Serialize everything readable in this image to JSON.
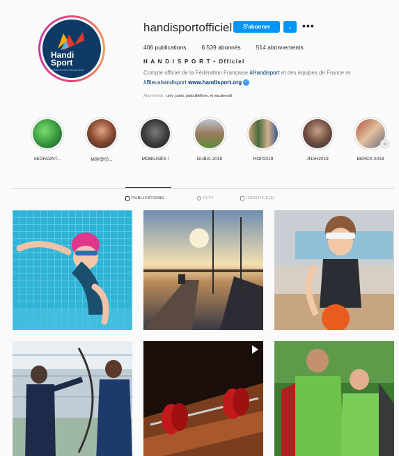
{
  "profile": {
    "username": "handisportofficiel",
    "follow_label": "S'abonner",
    "dropdown_glyph": "⌄",
    "more_glyph": "•••",
    "stats": {
      "publications": "406 publications",
      "followers": "6 539 abonnés",
      "following": "514 abonnements"
    },
    "fullname": "H A N D I S P O R T • Officiel",
    "bio_line1_prefix": "Compte officiel de la Fédération Française ",
    "bio_line1_tag": "#Handisport",
    "bio_line1_suffix": " et des équipes de France re",
    "bio_line2_tag": "#Bleushandisport",
    "bio_link": "www.handisport.org",
    "verified_glyph": "✓",
    "followed_by_prefix": "Abonné(e)s : ",
    "followed_by_names": "univ_paris, patouillefiore, et via.aterodi",
    "avatar_text_line1": "Handi",
    "avatar_text_line2": "Sport",
    "avatar_sub": "FÉDÉRATION FRANÇAISE"
  },
  "highlights": [
    {
      "label": "#EDFADNT..."
    },
    {
      "label": "M😢😍😑..."
    },
    {
      "label": "MOBILISÉS !"
    },
    {
      "label": "DUBAI 2019"
    },
    {
      "label": "HOP2019"
    },
    {
      "label": "JNAH2019"
    },
    {
      "label": "BERCK 2018"
    }
  ],
  "highlight_arrow": "›",
  "tabs": [
    {
      "label": "PUBLICATIONS",
      "active": true
    },
    {
      "label": "IGTV",
      "active": false
    },
    {
      "label": "IDENTIFIÉ(E)",
      "active": false
    }
  ],
  "colors": {
    "accent": "#0095f6",
    "link": "#00376b",
    "avatar_bg": "#0f3a66"
  },
  "posts": [
    {
      "subject": "child swimming with pink cap"
    },
    {
      "subject": "sunset over harbor pier"
    },
    {
      "subject": "blindfolded child with orange ball"
    },
    {
      "subject": "archery coaching"
    },
    {
      "subject": "red weights on bench",
      "video": true
    },
    {
      "subject": "athletes in green bibs"
    }
  ]
}
